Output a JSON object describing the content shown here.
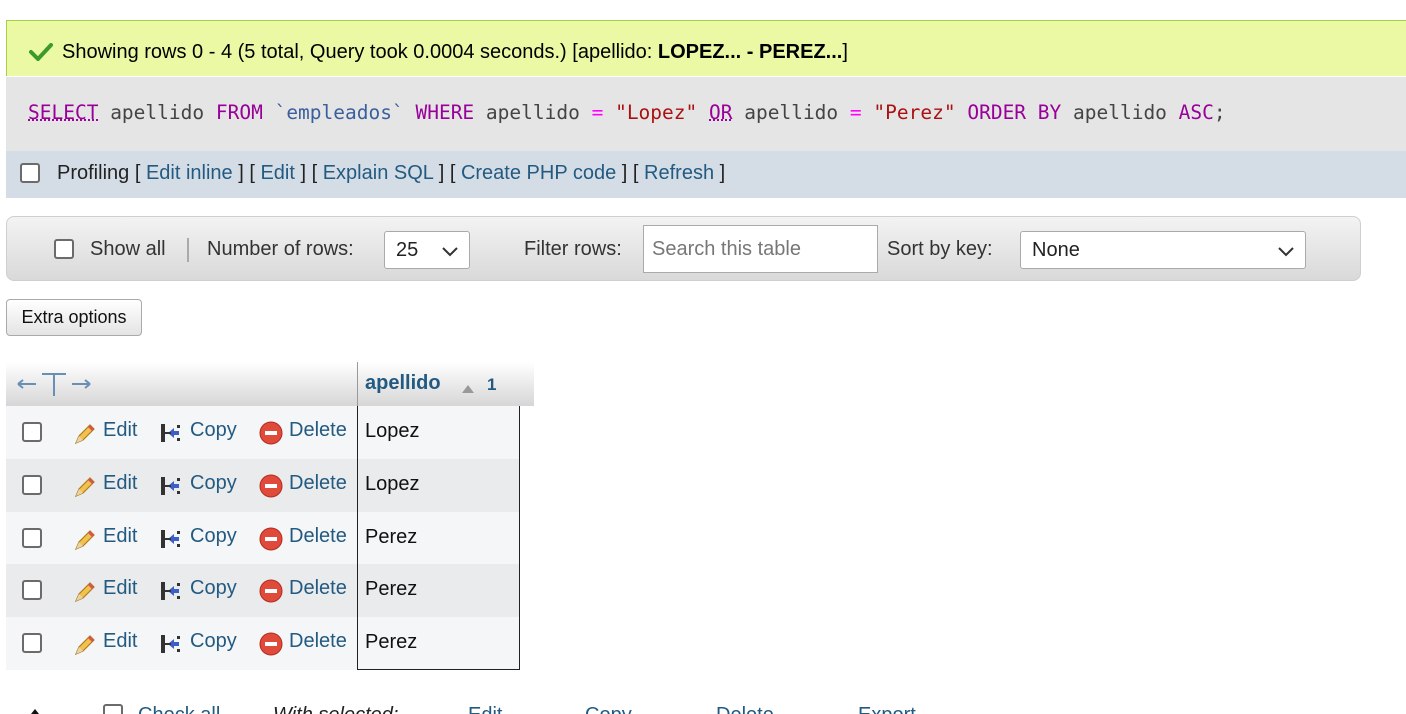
{
  "banner": {
    "prefix": "Showing rows 0 - 4 (5 total, Query took 0.0004 seconds.) [apellido: ",
    "bold": "LOPEZ... - PEREZ...",
    "suffix": "]",
    "color": "#ebf8a4"
  },
  "sql": {
    "t1": "SELECT",
    "t2": " apellido ",
    "t3": "FROM",
    "t4": " ",
    "t5": "`empleados`",
    "t6": " ",
    "t7": "WHERE",
    "t8": " apellido ",
    "t9": "=",
    "t10": " ",
    "t11": "\"Lopez\"",
    "t12": " ",
    "t13": "OR",
    "t14": " apellido ",
    "t15": "=",
    "t16": " ",
    "t17": "\"Perez\"",
    "t18": " ",
    "t19": "ORDER BY",
    "t20": " apellido ",
    "t21": "ASC",
    "t22": ";"
  },
  "profiling": {
    "label": "Profiling",
    "links": [
      "Edit inline",
      "Edit",
      "Explain SQL",
      "Create PHP code",
      "Refresh"
    ]
  },
  "nav": {
    "show_all": "Show all",
    "rows_label": "Number of rows:",
    "rows_value": "25",
    "filter_label": "Filter rows:",
    "filter_placeholder": "Search this table",
    "sort_label": "Sort by key:",
    "sort_value": "None"
  },
  "extra_options": "Extra options",
  "table": {
    "column": "apellido",
    "sort_order": "1",
    "actions": {
      "edit": "Edit",
      "copy": "Copy",
      "delete": "Delete"
    },
    "rows": [
      "Lopez",
      "Lopez",
      "Perez",
      "Perez",
      "Perez"
    ]
  },
  "footer": {
    "check_all": "Check all",
    "with_selected": "With selected:",
    "edit": "Edit",
    "copy": "Copy",
    "delete": "Delete",
    "export": "Export"
  },
  "colors": {
    "link": "#235a81",
    "keyword": "#990099",
    "string": "#aa1111",
    "banner": "#ebf8a4"
  },
  "icons": [
    "check-icon",
    "pencil-icon",
    "copy-icon",
    "delete-icon",
    "sort-asc-icon",
    "column-arrows-icon",
    "chevron-down-icon"
  ]
}
